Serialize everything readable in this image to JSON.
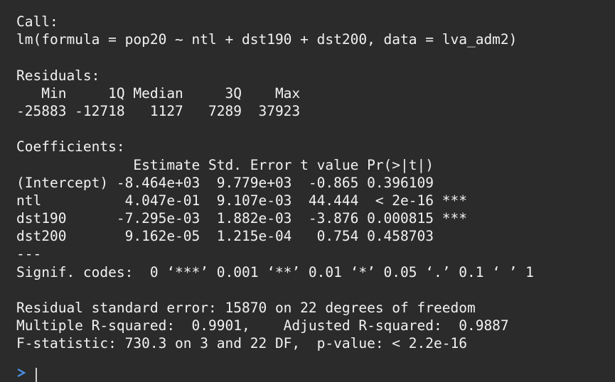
{
  "console": {
    "call_header": "Call:",
    "call_line": "lm(formula = pop20 ~ ntl + dst190 + dst200, data = lva_adm2)",
    "residuals_header": "Residuals:",
    "residuals_labels": "   Min     1Q Median     3Q    Max ",
    "residuals_values": "-25883 -12718   1127   7289  37923 ",
    "coefficients_header": "Coefficients:",
    "coef_header_row": "              Estimate Std. Error t value Pr(>|t|)    ",
    "coef_rows": [
      "(Intercept) -8.464e+03  9.779e+03  -0.865 0.396109    ",
      "ntl          4.047e-01  9.107e-03  44.444  < 2e-16 ***",
      "dst190      -7.295e-03  1.882e-03  -3.876 0.000815 ***",
      "dst200       9.162e-05  1.215e-04   0.754 0.458703    "
    ],
    "separator": "---",
    "signif_codes": "Signif. codes:  0 ‘***’ 0.001 ‘**’ 0.01 ‘*’ 0.05 ‘.’ 0.1 ‘ ’ 1",
    "residual_se": "Residual standard error: 15870 on 22 degrees of freedom",
    "r_squared": "Multiple R-squared:  0.9901,    Adjusted R-squared:  0.9887 ",
    "f_statistic": "F-statistic: 730.3 on 3 and 22 DF,  p-value: < 2.2e-16",
    "prompt_symbol": ">"
  },
  "colors": {
    "background": "#2b2b2b",
    "text": "#f2f2f2",
    "prompt": "#4a90e2"
  }
}
